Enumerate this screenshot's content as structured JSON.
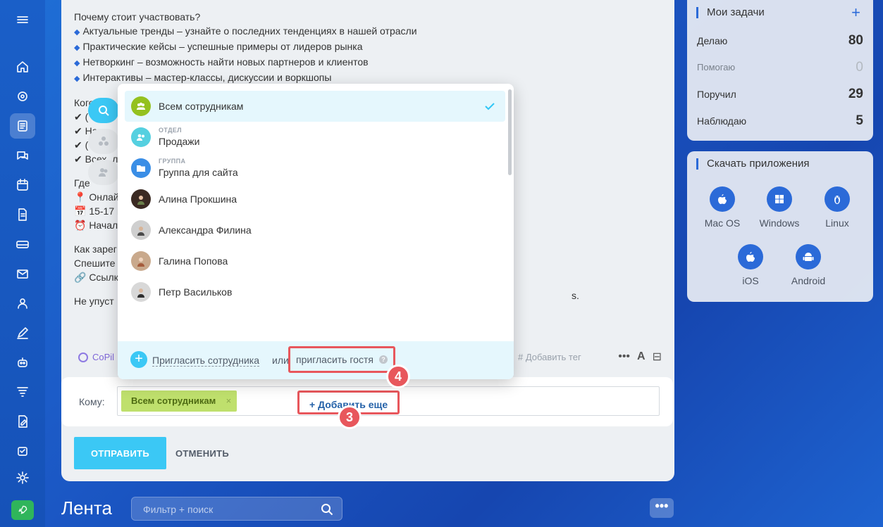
{
  "post": {
    "lines": [
      "Почему стоит участвовать?",
      "Актуальные тренды – узнайте о последних тенденциях в нашей отрасли",
      "Практические кейсы – успешные примеры от лидеров рынка",
      "Нетворкинг – возможность найти новых партнеров и клиентов",
      "Интерактивы – мастер-классы, дискуссии и воркшопы",
      "Кого м",
      "✔ (",
      "✔ Напи",
      "✔ (",
      "✔ Всех, л",
      "Где",
      "📍 Онлай",
      "📅 15-17 н",
      "⏰ Начало",
      "Как зарег",
      "Спешите",
      "🔗 Ссылк",
      "Не упуст"
    ],
    "tail": "s."
  },
  "toolbar": {
    "copilot": "CoPil",
    "add_tag": "Добавить тег"
  },
  "dropdown": {
    "items": [
      {
        "name": "Всем сотрудникам",
        "type": "",
        "selected": true
      },
      {
        "name": "Продажи",
        "type": "ОТДЕЛ"
      },
      {
        "name": "Группа для сайта",
        "type": "ГРУППА"
      },
      {
        "name": "Алина Прокшина",
        "type": ""
      },
      {
        "name": "Александра Филина",
        "type": ""
      },
      {
        "name": "Галина Попова",
        "type": ""
      },
      {
        "name": "Петр Васильков",
        "type": ""
      }
    ],
    "invite_employee": "Пригласить сотрудника",
    "or": "или",
    "invite_guest": "пригласить гостя",
    "help": "?"
  },
  "recipients": {
    "label": "Кому:",
    "chip": "Всем сотрудникам",
    "chip_remove": "×",
    "add_more": "+ Добавить еще"
  },
  "badges": {
    "step3": "3",
    "step4": "4"
  },
  "actions": {
    "send": "ОТПРАВИТЬ",
    "cancel": "ОТМЕНИТЬ"
  },
  "tasks": {
    "title": "Мои задачи",
    "add": "+",
    "rows": [
      {
        "label": "Делаю",
        "count": "80"
      },
      {
        "label": "Помогаю",
        "count": "0"
      },
      {
        "label": "Поручил",
        "count": "29"
      },
      {
        "label": "Наблюдаю",
        "count": "5"
      }
    ]
  },
  "apps": {
    "title": "Скачать приложения",
    "items": [
      {
        "name": "Mac OS",
        "icon": "apple-icon"
      },
      {
        "name": "Windows",
        "icon": "windows-icon"
      },
      {
        "name": "Linux",
        "icon": "linux-icon"
      },
      {
        "name": "iOS",
        "icon": "apple-icon"
      },
      {
        "name": "Android",
        "icon": "android-icon"
      }
    ]
  },
  "feed": {
    "title": "Лента",
    "filter_placeholder": "Фильтр + поиск",
    "more": "•••"
  },
  "colors": {
    "accent": "#2b6ad8",
    "highlight": "#e8575c",
    "chip": "#bfe06d",
    "send": "#3bc8f5"
  }
}
